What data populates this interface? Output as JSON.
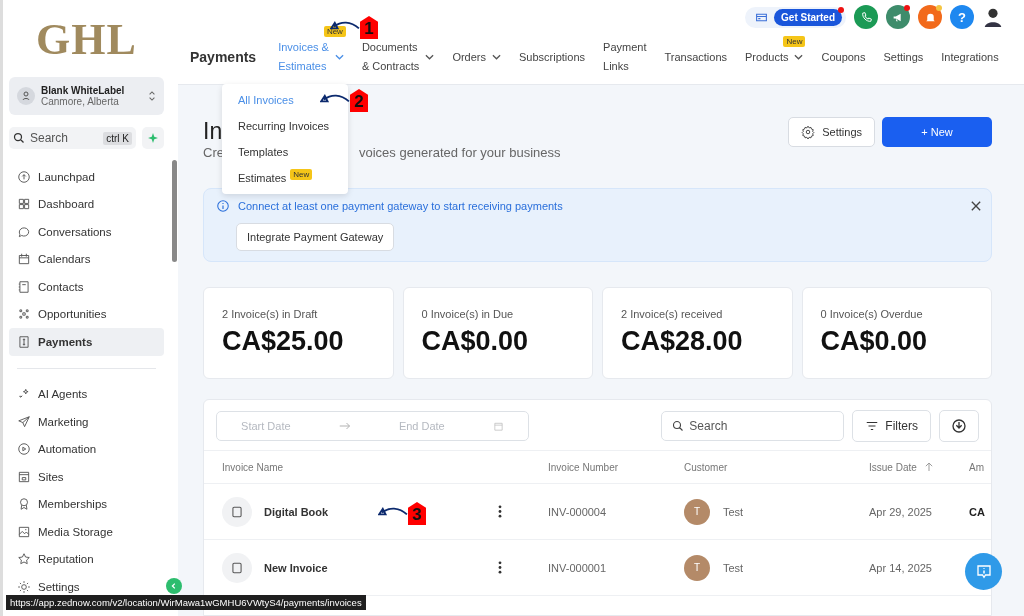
{
  "sidebar": {
    "logo": "GHL",
    "account": {
      "name": "Blank WhiteLabel",
      "location": "Canmore, Alberta"
    },
    "search": {
      "placeholder": "Search",
      "shortcut": "ctrl K"
    },
    "groups": [
      [
        {
          "label": "Launchpad",
          "selected": false
        },
        {
          "label": "Dashboard",
          "selected": false
        },
        {
          "label": "Conversations",
          "selected": false
        },
        {
          "label": "Calendars",
          "selected": false
        },
        {
          "label": "Contacts",
          "selected": false
        },
        {
          "label": "Opportunities",
          "selected": false
        },
        {
          "label": "Payments",
          "selected": true
        }
      ],
      [
        {
          "label": "AI Agents",
          "selected": false
        },
        {
          "label": "Marketing",
          "selected": false
        },
        {
          "label": "Automation",
          "selected": false
        },
        {
          "label": "Sites",
          "selected": false
        },
        {
          "label": "Memberships",
          "selected": false
        },
        {
          "label": "Media Storage",
          "selected": false
        },
        {
          "label": "Reputation",
          "selected": false
        },
        {
          "label": "Settings",
          "selected": false
        }
      ]
    ]
  },
  "topbar": {
    "get_started": "Get Started",
    "help": "?"
  },
  "nav": {
    "title": "Payments",
    "tabs": [
      {
        "label": "Invoices &\nEstimates",
        "selected": true,
        "dropdown": true,
        "badge": "New"
      },
      {
        "label": "Documents\n& Contracts",
        "selected": false,
        "dropdown": true
      },
      {
        "label": "Orders",
        "selected": false,
        "dropdown": true
      },
      {
        "label": "Subscriptions",
        "selected": false,
        "dropdown": false
      },
      {
        "label": "Payment\nLinks",
        "selected": false,
        "dropdown": false
      },
      {
        "label": "Transactions",
        "selected": false,
        "dropdown": false
      },
      {
        "label": "Products",
        "selected": false,
        "dropdown": true,
        "badge": "New"
      },
      {
        "label": "Coupons",
        "selected": false,
        "dropdown": false
      },
      {
        "label": "Settings",
        "selected": false,
        "dropdown": false
      },
      {
        "label": "Integrations",
        "selected": false,
        "dropdown": false
      }
    ]
  },
  "dropdown_menu": [
    {
      "label": "All Invoices",
      "selected": true
    },
    {
      "label": "Recurring Invoices",
      "selected": false
    },
    {
      "label": "Templates",
      "selected": false
    },
    {
      "label": "Estimates",
      "selected": false,
      "badge": "New"
    }
  ],
  "page": {
    "title": "In",
    "subtitle_start": "Cre",
    "subtitle_end": "voices generated for your business",
    "settings_button": "Settings",
    "new_button": "+ New"
  },
  "banner": {
    "message": "Connect at least one payment gateway to start receiving payments",
    "button": "Integrate Payment Gateway"
  },
  "stats": [
    {
      "label": "2 Invoice(s) in Draft",
      "value": "CA$25.00"
    },
    {
      "label": "0 Invoice(s) in Due",
      "value": "CA$0.00"
    },
    {
      "label": "2 Invoice(s) received",
      "value": "CA$28.00"
    },
    {
      "label": "0 Invoice(s) Overdue",
      "value": "CA$0.00"
    }
  ],
  "table": {
    "start_date": "Start Date",
    "end_date": "End Date",
    "search_placeholder": "Search",
    "filters": "Filters",
    "columns": [
      "Invoice Name",
      "",
      "Invoice Number",
      "Customer",
      "Issue Date",
      "Am"
    ],
    "rows": [
      {
        "name": "Digital Book",
        "number": "INV-000004",
        "customer_initial": "T",
        "customer": "Test",
        "date": "Apr 29, 2025",
        "amount": "CA"
      },
      {
        "name": "New Invoice",
        "number": "INV-000001",
        "customer_initial": "T",
        "customer": "Test",
        "date": "Apr 14, 2025"
      }
    ]
  },
  "annotations": [
    "1",
    "2",
    "3"
  ],
  "status_url": "https://app.zednow.com/v2/location/WirMawa1wGMHU6VWtyS4/payments/invoices"
}
